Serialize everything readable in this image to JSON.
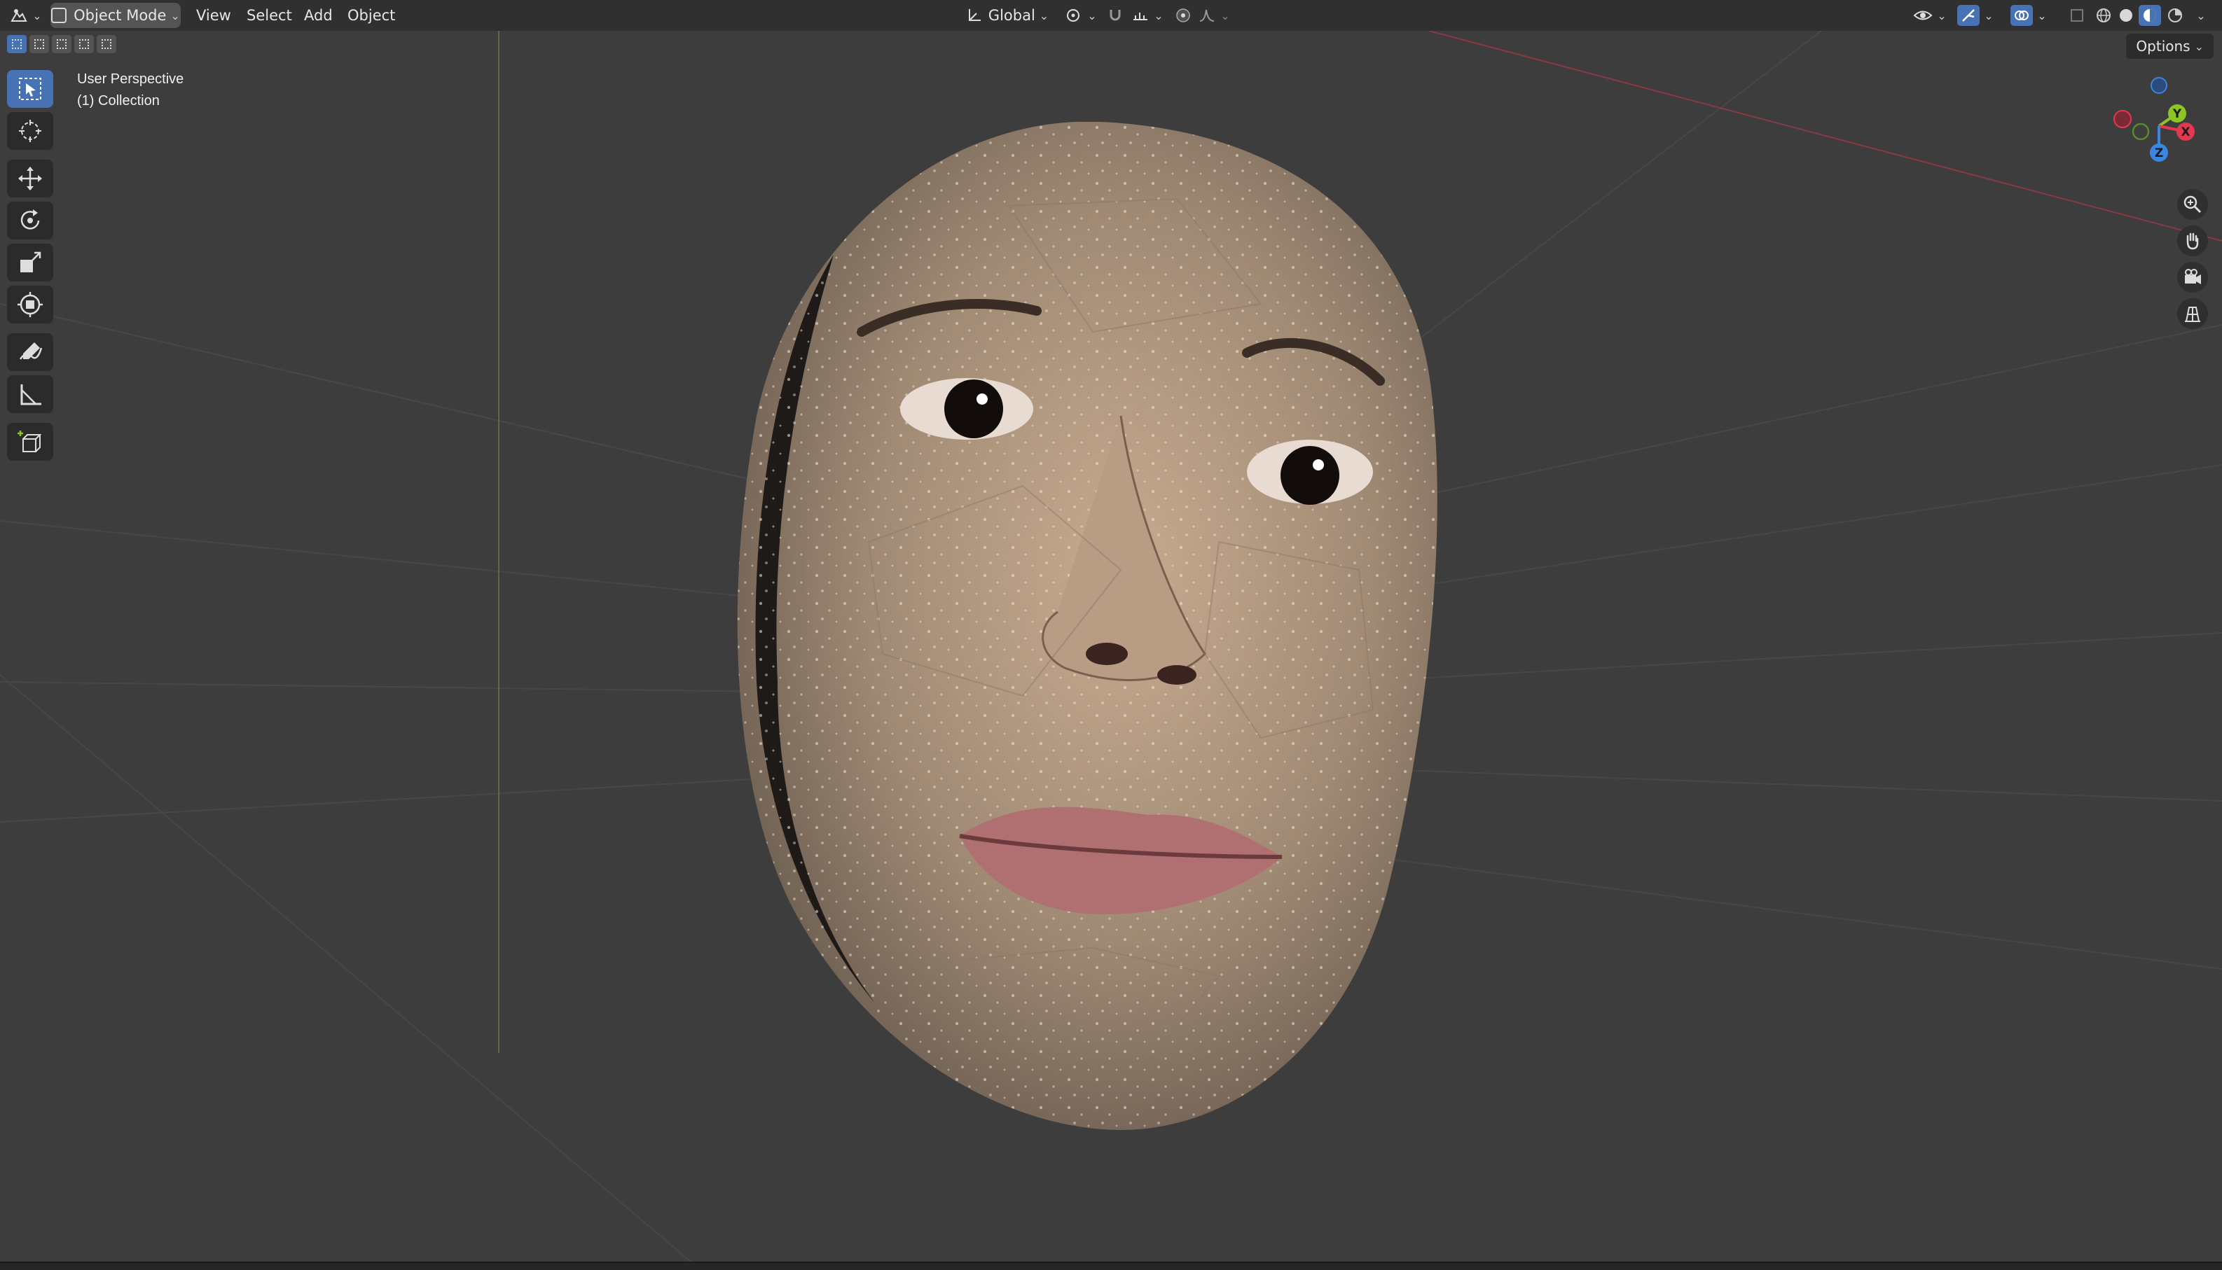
{
  "header": {
    "editor_type_icon": "editor-type-icon",
    "mode_label": "Object Mode",
    "menus": [
      "View",
      "Select",
      "Add",
      "Object"
    ],
    "transform_orientation": "Global"
  },
  "viewport": {
    "perspective_label": "User Perspective",
    "collection_label": "(1) Collection",
    "options_label": "Options"
  },
  "gizmo": {
    "x_label": "X",
    "y_label": "Y",
    "z_label": "Z",
    "x_color": "#e2394f",
    "y_color": "#8bc624",
    "z_color": "#3a86e0"
  },
  "toolbar": {
    "tools": [
      "select-box-tool",
      "cursor-tool",
      "move-tool",
      "rotate-tool",
      "scale-tool",
      "transform-tool",
      "annotate-tool",
      "measure-tool",
      "add-cube-tool"
    ]
  },
  "colors": {
    "accent": "#4772b3",
    "header_bg": "#303030",
    "viewport_bg": "#3d3d3d"
  }
}
